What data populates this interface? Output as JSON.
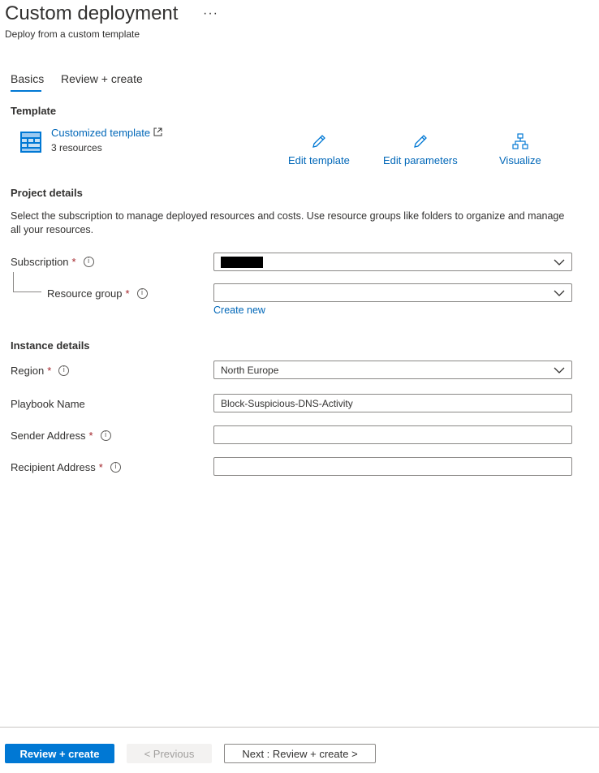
{
  "header": {
    "title": "Custom deployment",
    "more_label": "···",
    "subtitle": "Deploy from a custom template"
  },
  "tabs": [
    {
      "label": "Basics",
      "selected": true
    },
    {
      "label": "Review + create",
      "selected": false
    }
  ],
  "template": {
    "section_title": "Template",
    "name": "Customized template",
    "resources": "3 resources",
    "actions": [
      {
        "label": "Edit template",
        "icon": "pencil-icon"
      },
      {
        "label": "Edit parameters",
        "icon": "pencil-icon"
      },
      {
        "label": "Visualize",
        "icon": "hierarchy-icon"
      }
    ]
  },
  "project": {
    "section_title": "Project details",
    "description": "Select the subscription to manage deployed resources and costs. Use resource groups like folders to organize and manage all your resources.",
    "subscription_label": "Subscription",
    "subscription_value": "",
    "resource_group_label": "Resource group",
    "resource_group_value": "",
    "create_new": "Create new"
  },
  "instance": {
    "section_title": "Instance details",
    "region_label": "Region",
    "region_value": "North Europe",
    "playbook_label": "Playbook Name",
    "playbook_value": "Block-Suspicious-DNS-Activity",
    "sender_label": "Sender Address",
    "sender_value": "",
    "recipient_label": "Recipient Address",
    "recipient_value": ""
  },
  "common": {
    "required_mark": "*",
    "info_glyph": "i"
  },
  "footer": {
    "review_create": "Review + create",
    "previous": "< Previous",
    "next": "Next : Review + create >"
  },
  "colors": {
    "accent": "#0078d4",
    "link": "#0067b8",
    "required": "#a4262c"
  }
}
